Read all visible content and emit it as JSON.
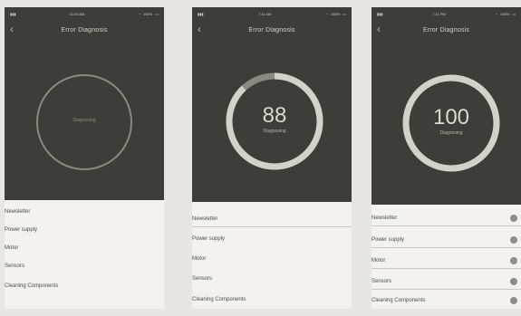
{
  "screens": [
    {
      "status_time": "11:00 AM",
      "status_right": "100%",
      "title": "Error Diagnosis",
      "gauge_value": "",
      "gauge_label": "Diagnosing",
      "progress": 0,
      "items": [
        "Newsletter",
        "Power supply",
        "Motor",
        "Sensors",
        "Cleaning Components"
      ]
    },
    {
      "status_time": "7:11 AM",
      "status_right": "100%",
      "title": "Error Diagnosis",
      "gauge_value": "88",
      "gauge_label": "Diagnosing",
      "progress": 0.88,
      "items": [
        "Newsletter",
        "Power supply",
        "Motor",
        "Sensors",
        "Cleaning Components"
      ]
    },
    {
      "status_time": "7:11 PM",
      "status_right": "100%",
      "title": "Error Diagnosis",
      "gauge_value": "100",
      "gauge_label": "Diagnosing",
      "progress": 1,
      "items": [
        "Newsletter",
        "Power supply",
        "Motor",
        "Sensors",
        "Cleaning Components"
      ]
    }
  ],
  "colors": {
    "screen_bg": "#3d3d39",
    "ring_track": "#8a8a84",
    "ring_fill": "#d2d2cc",
    "list_bg": "#f3f2ef",
    "dot": "#8d8c88"
  },
  "icons": {
    "back": "chevron-left-icon",
    "wifi": "wifi-icon",
    "battery": "battery-icon",
    "signal": "signal-icon"
  }
}
